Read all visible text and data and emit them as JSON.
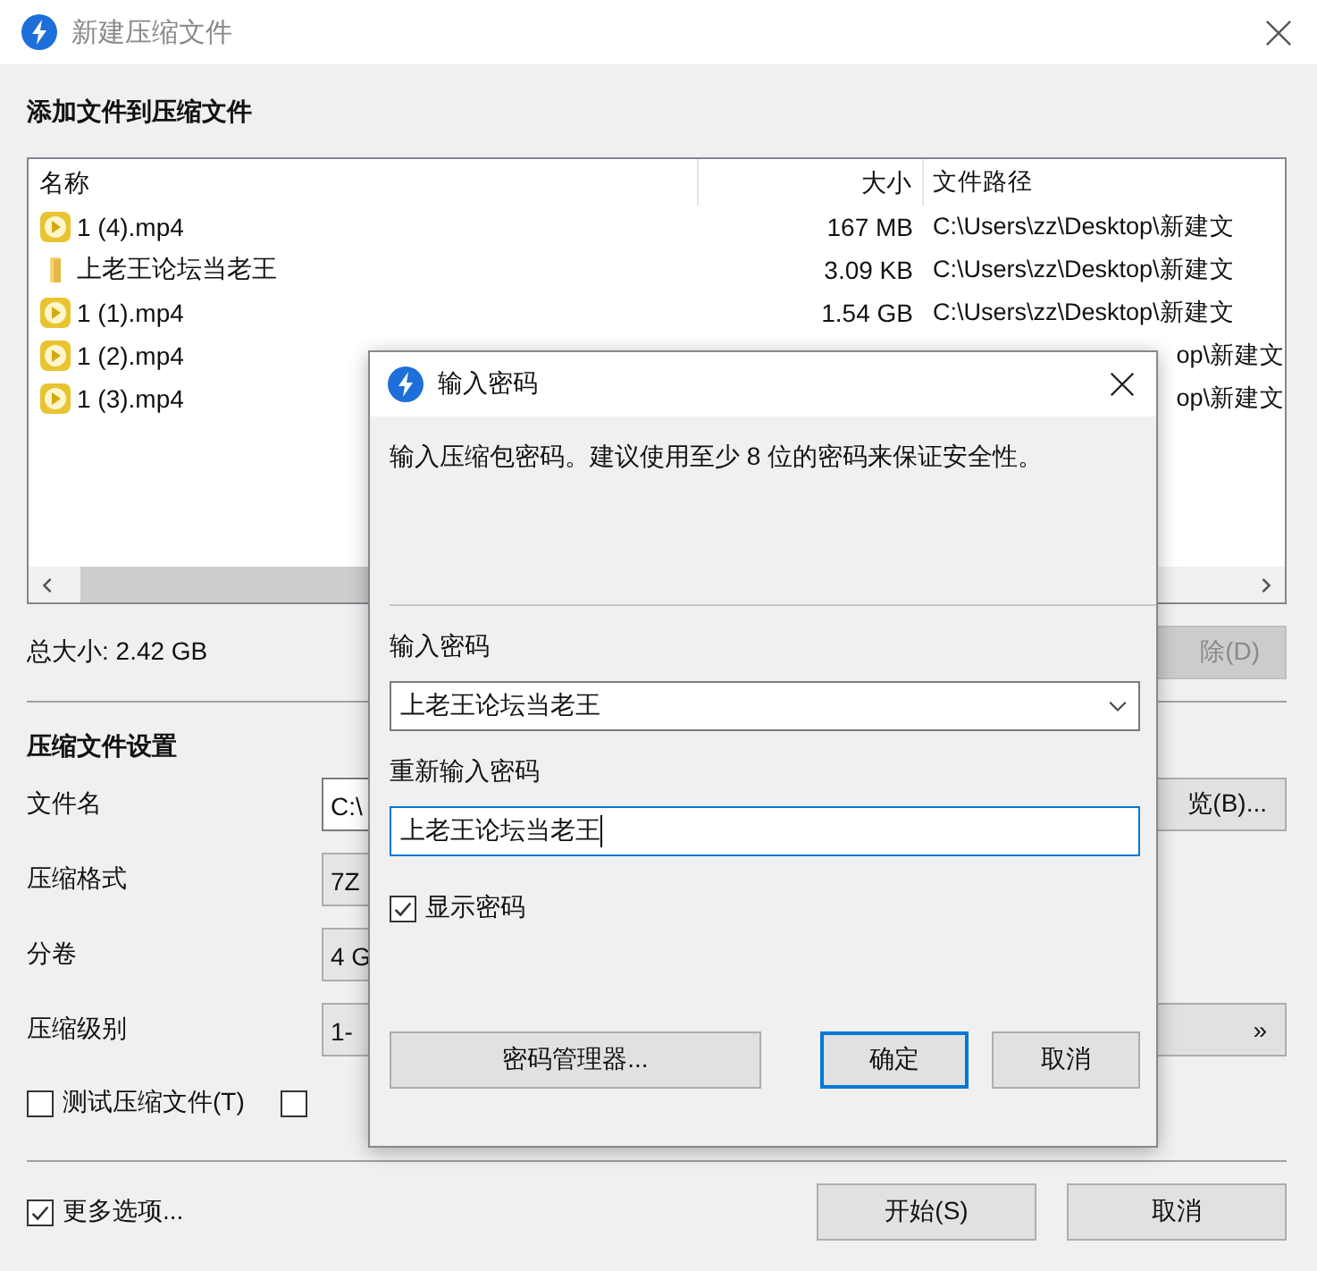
{
  "window": {
    "title": "新建压缩文件"
  },
  "section_title": "添加文件到压缩文件",
  "file_list": {
    "columns": [
      "名称",
      "大小",
      "文件路径"
    ],
    "rows": [
      {
        "kind": "video",
        "name": "1 (4).mp4",
        "size": "167 MB",
        "path": "C:\\Users\\zz\\Desktop\\新建文"
      },
      {
        "kind": "folder",
        "name": "上老王论坛当老王",
        "size": "3.09 KB",
        "path": "C:\\Users\\zz\\Desktop\\新建文"
      },
      {
        "kind": "video",
        "name": "1 (1).mp4",
        "size": "1.54 GB",
        "path": "C:\\Users\\zz\\Desktop\\新建文"
      },
      {
        "kind": "video",
        "name": "1 (2).mp4",
        "path": "op\\新建文"
      },
      {
        "kind": "video",
        "name": "1 (3).mp4",
        "path": "op\\新建文"
      }
    ]
  },
  "total_size": "总大小: 2.42 GB",
  "remove_button": {
    "label": "除(D)",
    "disabled": true
  },
  "settings_title": "压缩文件设置",
  "settings": [
    {
      "label": "文件名",
      "kind": "text",
      "value": "C:\\",
      "button": "览(B)..."
    },
    {
      "label": "压缩格式",
      "kind": "combo",
      "value": "7Z"
    },
    {
      "label": "分卷",
      "kind": "combo",
      "value": "4 G"
    },
    {
      "label": "压缩级别",
      "kind": "combo",
      "value": "1-",
      "button": "»"
    }
  ],
  "options": [
    {
      "label": "测试压缩文件(T)",
      "checked": false
    },
    {
      "checked": false
    }
  ],
  "more_options": {
    "label": "更多选项...",
    "checked": true
  },
  "buttons": [
    "开始(S)",
    "取消"
  ],
  "dialog": {
    "title": "输入密码",
    "message": "输入压缩包密码。建议使用至少 8 位的密码来保证安全性。",
    "password_label": "输入密码",
    "password": "上老王论坛当老王",
    "confirm_label": "重新输入密码",
    "confirm": "上老王论坛当老王",
    "show_password": {
      "label": "显示密码",
      "checked": true
    },
    "buttons": [
      {
        "label": "密码管理器...",
        "default": false
      },
      {
        "label": "确定",
        "default": true
      },
      {
        "label": "取消",
        "default": false
      }
    ]
  }
}
